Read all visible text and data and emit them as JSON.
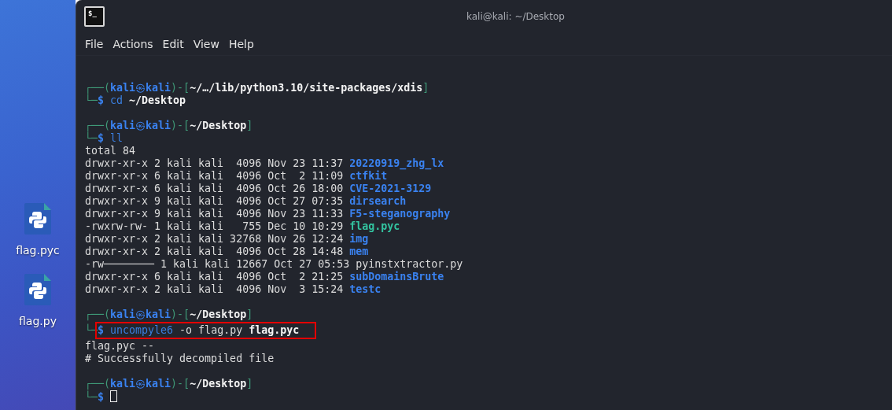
{
  "desktop": {
    "icons": [
      {
        "label": "flag.pyc"
      },
      {
        "label": "flag.py"
      }
    ]
  },
  "window": {
    "icon_text": "$_",
    "title": "kali@kali: ~/Desktop"
  },
  "menu": [
    "File",
    "Actions",
    "Edit",
    "View",
    "Help"
  ],
  "terminal": {
    "blocks": [
      {
        "prompt": {
          "frame_top": "┌──(",
          "user": "kali",
          "symbol": "㉿",
          "host": "kali",
          "frame_mid": ")-[",
          "path": "~/…/lib/python3.10/site-packages/xdis",
          "frame_end": "]",
          "frame_bottom": "└─",
          "dollar": "$"
        },
        "command": {
          "program": "cd",
          "args": "**~/Desktop**"
        },
        "highlighted": false,
        "cursor": false
      },
      {
        "prompt": {
          "frame_top": "┌──(",
          "user": "kali",
          "symbol": "㉿",
          "host": "kali",
          "frame_mid": ")-[",
          "path": "~/Desktop",
          "frame_end": "]",
          "frame_bottom": "└─",
          "dollar": "$"
        },
        "command": {
          "program": "ll"
        },
        "highlighted": false,
        "cursor": false,
        "output": [
          {
            "kind": "text",
            "text": "total 84"
          }
        ],
        "listing": [
          {
            "details": "drwxr-xr-x 2 kali kali  4096 Nov 23 11:37",
            "name": "20220919_zhg_lx",
            "kind": "directory"
          },
          {
            "details": "drwxr-xr-x 6 kali kali  4096 Oct  2 11:09",
            "name": "ctfkit",
            "kind": "directory"
          },
          {
            "details": "drwxr-xr-x 6 kali kali  4096 Oct 26 18:00",
            "name": "CVE-2021-3129",
            "kind": "directory"
          },
          {
            "details": "drwxr-xr-x 9 kali kali  4096 Oct 27 07:35",
            "name": "dirsearch",
            "kind": "directory"
          },
          {
            "details": "drwxr-xr-x 9 kali kali  4096 Nov 23 11:33",
            "name": "F5-steganography",
            "kind": "directory"
          },
          {
            "details": "-rwxrw-rw- 1 kali kali   755 Dec 10 10:29",
            "name": "flag.pyc",
            "kind": "executable"
          },
          {
            "details": "drwxr-xr-x 2 kali kali 32768 Nov 26 12:24",
            "name": "img",
            "kind": "directory"
          },
          {
            "details": "drwxr-xr-x 2 kali kali  4096 Oct 28 14:48",
            "name": "mem",
            "kind": "directory"
          },
          {
            "details": "-rw──────── 1 kali kali 12667 Oct 27 05:53",
            "name": "pyinstxtractor.py",
            "kind": "file"
          },
          {
            "details": "drwxr-xr-x 6 kali kali  4096 Oct  2 21:25",
            "name": "subDomainsBrute",
            "kind": "directory"
          },
          {
            "details": "drwxr-xr-x 2 kali kali  4096 Nov  3 15:24",
            "name": "testc",
            "kind": "directory"
          }
        ]
      },
      {
        "prompt": {
          "frame_top": "┌──(",
          "user": "kali",
          "symbol": "㉿",
          "host": "kali",
          "frame_mid": ")-[",
          "path": "~/Desktop",
          "frame_end": "]",
          "frame_bottom": "└─",
          "dollar": "$"
        },
        "command": {
          "program": "uncompyle6",
          "args": "-o flag.py **flag.pyc**"
        },
        "highlighted": true,
        "cursor": false,
        "output": [
          {
            "kind": "text",
            "text": "flag.pyc --"
          },
          {
            "kind": "text",
            "text": "# Successfully decompiled file"
          }
        ]
      },
      {
        "prompt": {
          "frame_top": "┌──(",
          "user": "kali",
          "symbol": "㉿",
          "host": "kali",
          "frame_mid": ")-[",
          "path": "~/Desktop",
          "frame_end": "]",
          "frame_bottom": "└─",
          "dollar": "$"
        },
        "highlighted": false,
        "cursor": true
      }
    ]
  }
}
